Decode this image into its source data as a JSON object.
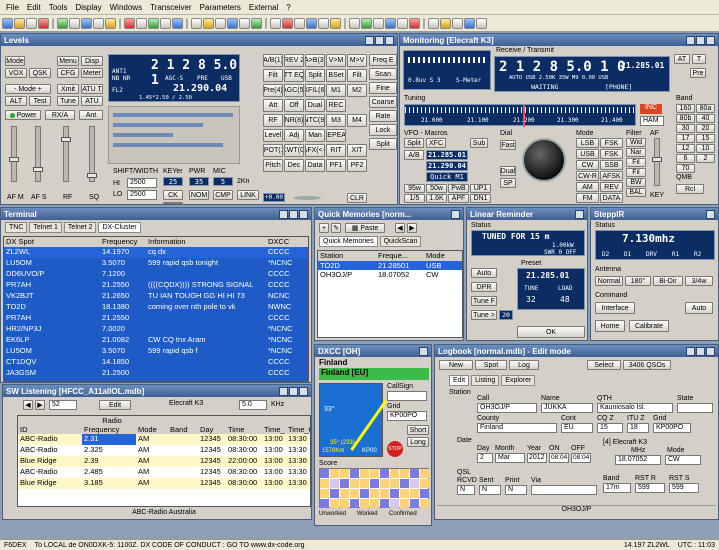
{
  "menu": [
    "File",
    "Edit",
    "Tools",
    "Display",
    "Windows",
    "Transceiver",
    "Parameters",
    "External",
    "?"
  ],
  "levels": {
    "title": "Levels",
    "freq": "2 1 2 8 5.0 1",
    "ant": "ANT1",
    "nb": "NB",
    "nr": "NR",
    "agc": "AGC-S",
    "pre": "PRE",
    "mode": "USB",
    "fl": "FL2",
    "vfo_b": "21.290.04",
    "filter": "1.45*2.50 / 2.50",
    "left_btns": [
      "Mode",
      "Menu",
      "Disp",
      "VOX",
      "QSK",
      "CFG",
      "Meter",
      "- Mode +",
      "Xmit",
      "ATU T",
      "ALT",
      "Test",
      "Tune",
      "ATU"
    ],
    "power": "Power",
    "rxa": "RX/A",
    "ant_btn": "Ant",
    "slider_labels": [
      "AF M",
      "AF S",
      "RF",
      "SQ"
    ],
    "shift": "SHIFT/WIDTH",
    "keyer": "KEYer",
    "pwr": "PWR",
    "mic": "MIC",
    "keyer_val": "25",
    "pwr_val": "35",
    "mic_val": "5",
    "hi": "HI",
    "lo": "LO",
    "hi_val": "2500",
    "lo_val": "2500",
    "ck": "CK",
    "kon": "2Kn",
    "nom": "NOM",
    "cmp": "CMP",
    "link": "LINK",
    "ab_btns": [
      "A/B(1)",
      "REV 2",
      "A>B(3)",
      "V>M",
      "M>V",
      "Filt",
      "TT EQ",
      "Split",
      "BSet",
      "Filt",
      "Pre(4)",
      "AGC(5)",
      "XFIL(6)",
      "M1",
      "M2",
      "Att",
      "Off",
      "Dual",
      "REC",
      "",
      "RF",
      "NR(8)",
      "NTC(9)",
      "M3",
      "M4",
      "Level",
      "Adj",
      "Man",
      "REPEAT",
      "",
      "SPOT(1)",
      "CWT(0)",
      "AFX(<-)",
      "RIT",
      "XIT",
      "Pitch",
      "Dec",
      "Data",
      "PF1",
      "PF2"
    ],
    "side_btns": [
      "Freq E",
      "Scan",
      "Fine",
      "Coarse",
      "Rate",
      "Lock",
      "Split"
    ],
    "offset": "+0.00",
    "sub": "Sub",
    "dial": "Dial",
    "clr": "CLR",
    "zero": "0.00",
    "fast": "Fast"
  },
  "monitor": {
    "title": "Monitoring [Elecraft K3]",
    "rt": "Receive / Transmit",
    "freq": "2 1 2 8 5.0 1 0",
    "freq_b": "21.285.01",
    "sub_line": "AUTO USB 2.50K   35W M9   0.00 USB",
    "waiting": "WAITING",
    "phone": "[PHONE]",
    "smeter": "S-Meter",
    "dbm": "0.8uv S 3",
    "at": "AT",
    "t": "T",
    "pre": "Pre",
    "tuning": "Tuning",
    "ticks": [
      "21.000",
      "21.100",
      "21.200",
      "21.300",
      "21.400"
    ],
    "inc": "INC",
    "ham": "HAM",
    "vfo_macros": "VFO - Macros",
    "split": "Split",
    "xfc": "XFC",
    "sub": "Sub",
    "ab": "A/B",
    "a_freq": "21.285.01",
    "b_freq": "21.290.04",
    "quick": "Quick M1",
    "plus_btns": [
      "95w",
      "50w",
      "PwB",
      "UP1",
      "1/5",
      "1.6K",
      "APF",
      "DN1"
    ],
    "dial": "Dial",
    "fast": "Fast",
    "sp": "SP",
    "dual": "Dual",
    "swr": "SWR",
    "mode": "Mode",
    "modes": [
      "LSB",
      "FSK",
      "USB",
      "FSK",
      "CW",
      "SSB",
      "CW-R",
      "AFSK",
      "AM",
      "REV",
      "FM",
      "DATA"
    ],
    "filter": "Filter",
    "filters": [
      "Wid",
      "Nar",
      "Fil",
      "Fil",
      "BW",
      "BAL"
    ],
    "af": "AF",
    "qmb": "QMB",
    "rcl": "Rcl",
    "key": "KEY",
    "band": "Band",
    "bands": [
      "160",
      "80a",
      "80b",
      "40",
      "30",
      "20",
      "17",
      "15",
      "12",
      "10",
      "6",
      "2",
      "70"
    ],
    "band_labels": [
      "160m",
      "80m",
      "40m",
      "30m",
      "20m",
      "17m",
      "15m",
      "12m",
      "10m",
      "6m",
      "2m",
      "70c"
    ]
  },
  "terminal": {
    "title": "Terminal",
    "tabs": [
      "TNC",
      "Telnet 1",
      "Telnet 2",
      "DX-Cluster"
    ],
    "cols": [
      "DX Spot",
      "Frequency",
      "Information",
      "DXCC"
    ],
    "rows": [
      [
        "ZL2WL",
        "14.1970",
        "cq dx",
        "CCCC"
      ],
      [
        "LU5OM",
        "3.5070",
        "599 rapid qsb tonight",
        "*NCNC"
      ],
      [
        "DD6UVO/P",
        "7.1200",
        "",
        "CCCC"
      ],
      [
        "PR7AH",
        "21.2550",
        "((((CQDX)))) STRONG SIGNAL",
        "CCCC"
      ],
      [
        "VK2BJT",
        "21.2650",
        "TU IAN TOUGH GG HI HI 73",
        "NCNC"
      ],
      [
        "TO2D",
        "18.1380",
        "coming over nth pole to vk",
        "NWNC"
      ],
      [
        "PR7AH",
        "21.2550",
        "",
        "CCCC"
      ],
      [
        "HR2/NP3J",
        "7.0020",
        "",
        "*NCNC"
      ],
      [
        "EK6LP",
        "21.0082",
        "CW CQ tnx Aram",
        "*NCNC"
      ],
      [
        "LU5OM",
        "3.5070",
        "599 rapid qsb f",
        "*NCNC"
      ],
      [
        "CT1DQV",
        "14.1850",
        "",
        "CCCC"
      ],
      [
        "JA3GSM",
        "21.2500",
        "",
        "CCCC"
      ]
    ]
  },
  "quick": {
    "title": "Quick Memories [norm...",
    "paste": "Paste",
    "tabs": [
      "Quick Memories",
      "QuickScan"
    ],
    "cols": [
      "Station",
      "Freque...",
      "Mode"
    ],
    "rows": [
      [
        "TO2D",
        "21.28501",
        "USB"
      ],
      [
        "OH3OJ/P",
        "18.07052",
        "CW"
      ]
    ]
  },
  "linear": {
    "title": "Linear Reminder",
    "status": "Status",
    "tuned": "TUNED FOR 15 m",
    "kw": "1.00kW",
    "swr": "SWR 0 OFF",
    "auto": "Auto",
    "dpr": "DPR",
    "tune_f": "Tune F",
    "tune_g": "Tune >",
    "twenty": "20",
    "preset": "Preset",
    "freq": "21.285.01",
    "tune": "TUNE",
    "load": "LOAD",
    "tune_v": "32",
    "load_v": "48",
    "ok": "OK"
  },
  "steppir": {
    "title": "SteppIR",
    "status": "Status",
    "freq": "7.130mhz",
    "dir_labels": [
      "D2",
      "D1",
      "DRV",
      "R1",
      "R2"
    ],
    "antenna": "Antenna",
    "ant_btns": [
      "Normal",
      "180°",
      "Bi-Dir",
      "3/4w"
    ],
    "command": "Command",
    "interface": "Interface",
    "auto": "Auto",
    "home": "Home",
    "calibrate": "Calibrate"
  },
  "dxcc": {
    "title": "DXCC [OH]",
    "country": "Finland",
    "entity": "Finland [EU]",
    "callsign": "CallSign",
    "grid": "Grid",
    "grid_val": "KP00PO",
    "lat": "33°",
    "bearing": "35° (233)",
    "dist": "1578Km",
    "kp": "KP00",
    "short": "Short",
    "long": "Long",
    "stop": "STOP",
    "score": "Score",
    "legend": [
      "Unworked",
      "Worked",
      "Confirmed"
    ]
  },
  "listening": {
    "title": "SW Listening [HFCC_A11allOL.mdb]",
    "num": "52",
    "edit": "Edit",
    "radio": "Elecraft K3",
    "step": "5.0",
    "khz": "KHz",
    "cols": [
      "ID",
      "Frequency",
      "Mode",
      "Band",
      "Day",
      "Time"
    ],
    "rows": [
      [
        "ABC-Radio",
        "2.31",
        "AM",
        "",
        "12345",
        "08:30:00"
      ],
      [
        "ABC-Radio",
        "2.325",
        "AM",
        "",
        "12345",
        "08:30:00"
      ],
      [
        "Blue Ridge",
        "2.39",
        "AM",
        "",
        "12345",
        "22:00:00"
      ],
      [
        "ABC-Radio",
        "2.485",
        "AM",
        "",
        "12345",
        "08:30:00"
      ],
      [
        "Blue Ridge",
        "3.185",
        "AM",
        "",
        "12345",
        "08:30:00"
      ]
    ],
    "time_cols": [
      "Time_",
      "Time_C"
    ],
    "time_rows": [
      [
        "13:00",
        "13:30"
      ],
      [
        "13:00",
        "13:30"
      ],
      [
        "13:00",
        "13:30"
      ],
      [
        "13:00",
        "13:30"
      ],
      [
        "13:00",
        "13:30"
      ]
    ],
    "footer": "ABC-Radio Australia",
    "radio_label": "Radio"
  },
  "logbook": {
    "title": "Logbook [normal.mdb] - Edit mode",
    "new": "New",
    "spot": "Spot",
    "log": "Log",
    "select": "Select",
    "qsos": "3406 QSOs",
    "tabs": [
      "Edit",
      "Listing",
      "Explorer"
    ],
    "station": "Station",
    "call_l": "Call",
    "name_l": "Name",
    "qth_l": "QTH",
    "state_l": "State",
    "call": "OH3OJ/P",
    "name": "JUKKA",
    "qth": "Kauniosalo Isl.",
    "county_l": "County",
    "cont_l": "Cont",
    "cq_l": "CQ Z",
    "itu_l": "ITU Z",
    "grid_l": "Grid",
    "county": "Finland",
    "cont": "EU",
    "cq": "15",
    "itu": "18",
    "grid": "KP00PO",
    "date_l": "Date",
    "day_l": "Day",
    "month_l": "Month",
    "year_l": "Year",
    "on_l": "ON",
    "off_l": "OFF",
    "day": "2",
    "month": "Mar",
    "year": "2012",
    "on": "08:04",
    "off": "08:04",
    "radio_l": "[4] Elecraft K3",
    "mhz_l": "MHz",
    "mode_l": "Mode",
    "mhz": "18.07052",
    "mode": "CW",
    "qsl_l": "QSL",
    "rcvd_l": "RCVD",
    "sent_l": "Sent",
    "print_l": "Print",
    "via_l": "Via",
    "rcvd": "N",
    "sent": "N",
    "print": "N",
    "band_l": "Band",
    "rsta_l": "RST R",
    "rsts_l": "RST S",
    "band": "17m",
    "rsta": "599",
    "rsts": "599",
    "footer": "OH3OJ/P"
  },
  "status": {
    "left": "F6DEX",
    "msg": "To LOCAL de ON0DXK-5: 1100Z. DX CODE OF CONDUCT : GO TO www.dx-code.org",
    "spot": "14.197 ZL2WL",
    "utc": "UTC : 11:03"
  }
}
